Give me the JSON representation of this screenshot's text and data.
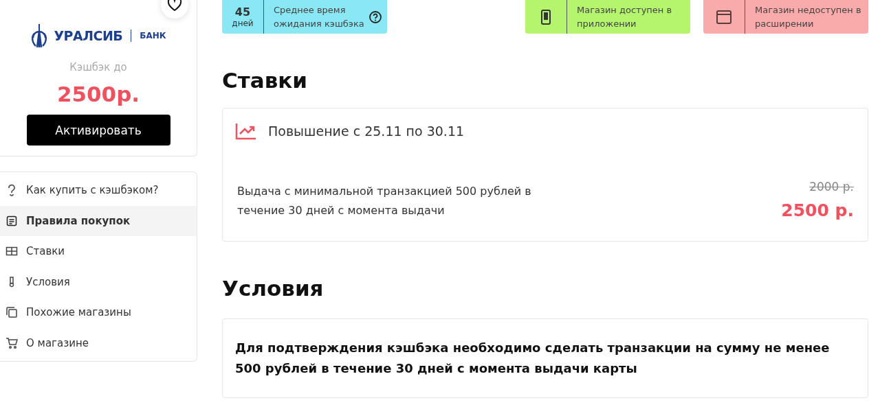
{
  "store_card": {
    "logo": {
      "name": "УРАЛСИБ",
      "suffix": "БАНК"
    },
    "cashback_label": "Кэшбэк до",
    "cashback_value": "2500р.",
    "activate_button": "Активировать",
    "favorite": false
  },
  "sidebar": {
    "items": [
      {
        "kind": "help",
        "label": "Как купить с кэшбэком?",
        "selected": false
      },
      {
        "kind": "rules",
        "label": "Правила покупок",
        "selected": true
      },
      {
        "kind": "rates",
        "label": "Ставки",
        "selected": false
      },
      {
        "kind": "conditions",
        "label": "Условия",
        "selected": false
      },
      {
        "kind": "similar",
        "label": "Похожие магазины",
        "selected": false
      },
      {
        "kind": "cart",
        "label": "О магазине",
        "selected": false
      }
    ]
  },
  "badges": [
    {
      "kind": "wait",
      "color": "#8ae8f5",
      "number": "45",
      "unit": "дней",
      "text": "Среднее время ожидания кэшбэка"
    },
    {
      "kind": "phone",
      "color": "#b5f56e",
      "text": "Магазин доступен в приложении"
    },
    {
      "kind": "browser",
      "color": "#f9abab",
      "text": "Магазин недоступен в расширении"
    }
  ],
  "rates": {
    "heading": "Ставки",
    "promo": "Повышение с 25.11 по 30.11",
    "description": "Выдача с минимальной транзакцией 500 рублей в течение 30 дней с момента выдачи",
    "old_value": "2000 р.",
    "new_value": "2500 р."
  },
  "conditions": {
    "heading": "Условия",
    "text": "Для подтверждения кэшбэка необходимо сделать транзакции на сумму не менее 500 рублей в течение 30 дней с момента выдачи карты"
  }
}
